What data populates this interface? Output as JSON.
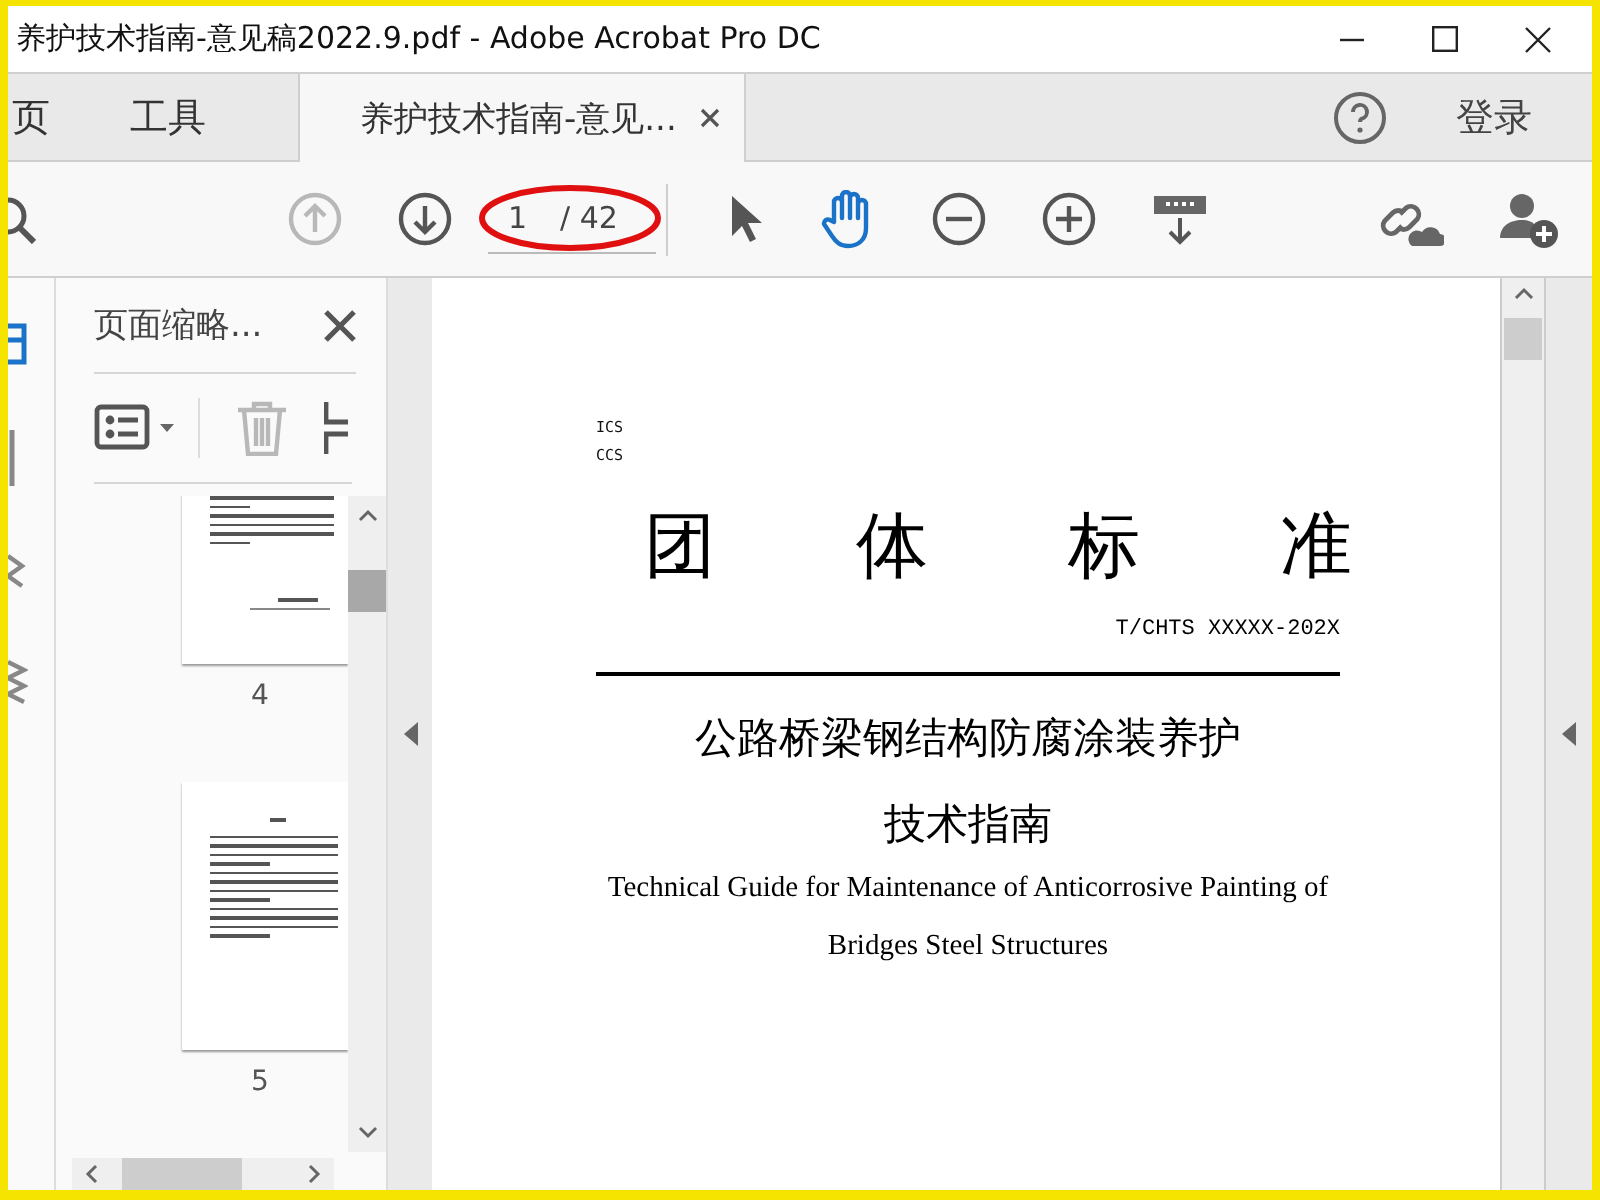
{
  "window": {
    "title": "养护技术指南-意见稿2022.9.pdf - Adobe Acrobat Pro DC"
  },
  "tabs": [
    {
      "label": "页",
      "selected": false
    },
    {
      "label": "工具",
      "selected": false
    },
    {
      "label": "养护技术指南-意见...",
      "selected": true
    }
  ],
  "account": {
    "login": "登录"
  },
  "toolbar": {
    "nav": [
      {
        "kind": "prev",
        "disabled": true
      },
      {
        "kind": "next",
        "disabled": false
      }
    ],
    "page_input": "1",
    "page_total": "/ 42",
    "tools": [
      {
        "kind": "select",
        "selected": false
      },
      {
        "kind": "hand",
        "selected": true
      }
    ]
  },
  "sidebar": {
    "title": "页面缩略...",
    "thumbnails": [
      {
        "label": "4",
        "kind": "end"
      },
      {
        "label": "5",
        "kind": "text"
      }
    ]
  },
  "document": {
    "ics": "ICS",
    "ccs": "CCS",
    "heading_chars": [
      "团",
      "体",
      "标",
      "准"
    ],
    "code": "T/CHTS XXXXX-202X",
    "title_lines": [
      "公路桥梁钢结构防腐涂装养护",
      "技术指南"
    ],
    "english_lines": [
      "Technical Guide for Maintenance of Anticorrosive Painting of",
      "Bridges Steel Structures"
    ]
  }
}
